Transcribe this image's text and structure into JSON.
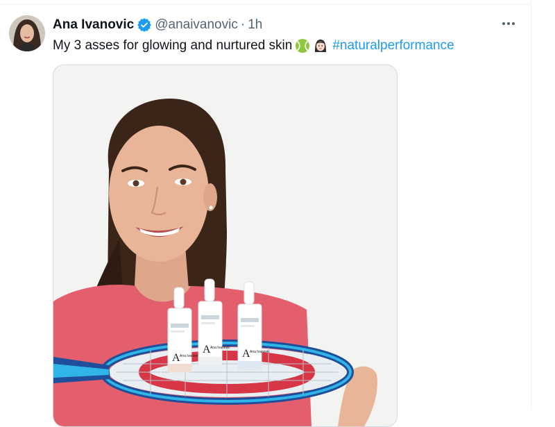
{
  "tweet": {
    "author": {
      "display_name": "Ana Ivanovic",
      "handle": "@anaivanovic",
      "verified": true
    },
    "separator": "·",
    "time": "1h",
    "text": "My 3 asses for glowing and nurtured skin",
    "emojis": [
      "tennis-ball-icon",
      "woman-face-icon"
    ],
    "hashtag": "#naturalperformance",
    "media": {
      "product_labels": [
        "Ana Ivanovic",
        "Ana Ivanovic",
        "Ana Ivanovic"
      ]
    }
  },
  "colors": {
    "link": "#1d9bf0",
    "secondary_text": "#536471",
    "verified": "#1d9bf0",
    "divider": "#eff3f4"
  }
}
